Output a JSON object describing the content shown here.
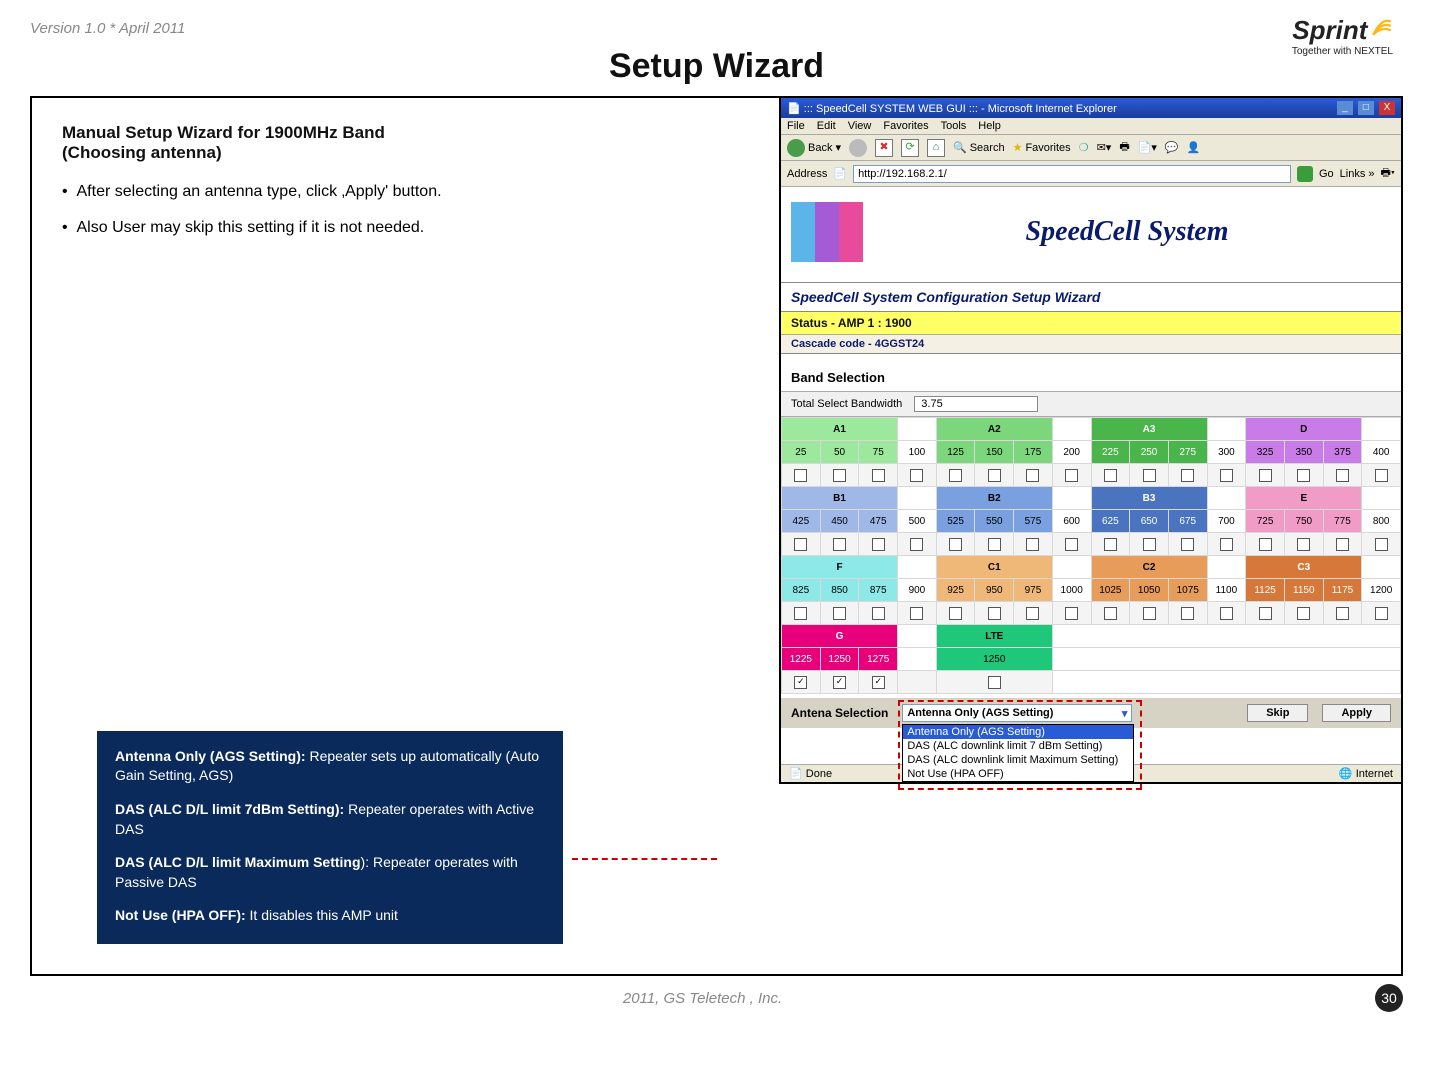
{
  "header": {
    "version_text": "Version 1.0 * April 2011",
    "logo_main": "Sprint",
    "logo_sub": "Together with NEXTEL"
  },
  "page_title": "Setup Wizard",
  "left_text": {
    "heading_line1": "Manual Setup Wizard for 1900MHz Band",
    "heading_line2": " (Choosing antenna)",
    "bullet1": "After selecting an antenna type, click ‚Apply' button.",
    "bullet2": "Also User may skip this setting if it is not needed."
  },
  "info_box": {
    "p1_bold": "Antenna Only (AGS Setting):",
    "p1_rest": "  Repeater sets up automatically (Auto Gain Setting, AGS)",
    "p2_bold": "DAS (ALC D/L limit 7dBm Setting):",
    "p2_rest": " Repeater operates with Active DAS",
    "p3_bold": "DAS (ALC D/L limit  Maximum Setting",
    "p3_rest": "): Repeater operates with Passive DAS",
    "p4_bold": "Not Use (HPA OFF):",
    "p4_rest": " It  disables this AMP unit"
  },
  "ie": {
    "title": "::: SpeedCell SYSTEM WEB GUI ::: - Microsoft Internet Explorer",
    "menus": [
      "File",
      "Edit",
      "View",
      "Favorites",
      "Tools",
      "Help"
    ],
    "back_label": "Back",
    "search_label": "Search",
    "favorites_label": "Favorites",
    "address_label": "Address",
    "address_value": "http://192.168.2.1/",
    "go_label": "Go",
    "links_label": "Links",
    "status_left": "Done",
    "status_right": "Internet"
  },
  "speedcell": {
    "title": "SpeedCell System",
    "wizard_header": "SpeedCell System Configuration Setup Wizard",
    "status_text": "Status - AMP 1 : 1900",
    "cascade_text": "Cascade code - 4GGST24",
    "band_selection_header": "Band Selection",
    "total_bw_label": "Total Select Bandwidth",
    "total_bw_value": "3.75"
  },
  "bands": {
    "row1_headers": [
      "A1",
      "A2",
      "A3",
      "D"
    ],
    "row1_freqs": [
      "25",
      "50",
      "75",
      "100",
      "125",
      "150",
      "175",
      "200",
      "225",
      "250",
      "275",
      "300",
      "325",
      "350",
      "375",
      "400"
    ],
    "row2_headers": [
      "B1",
      "B2",
      "B3",
      "E"
    ],
    "row2_freqs": [
      "425",
      "450",
      "475",
      "500",
      "525",
      "550",
      "575",
      "600",
      "625",
      "650",
      "675",
      "700",
      "725",
      "750",
      "775",
      "800"
    ],
    "row3_headers": [
      "F",
      "C1",
      "C2",
      "C3"
    ],
    "row3_freqs": [
      "825",
      "850",
      "875",
      "900",
      "925",
      "950",
      "975",
      "1000",
      "1025",
      "1050",
      "1075",
      "1100",
      "1125",
      "1150",
      "1175",
      "1200"
    ],
    "row4_headers": [
      "G",
      "LTE"
    ],
    "row4_freqs": [
      "1225",
      "1250",
      "1275",
      "1250"
    ]
  },
  "antenna": {
    "label": "Antena Selection",
    "selected": "Antenna Only (AGS Setting)",
    "options": [
      "Antenna Only (AGS Setting)",
      "DAS (ALC downlink limit 7 dBm Setting)",
      "DAS (ALC downlink limit Maximum Setting)",
      "Not Use (HPA OFF)"
    ],
    "skip_btn": "Skip",
    "apply_btn": "Apply"
  },
  "footer": {
    "copyright": "2011, GS Teletech , Inc.",
    "page_num": "30"
  }
}
